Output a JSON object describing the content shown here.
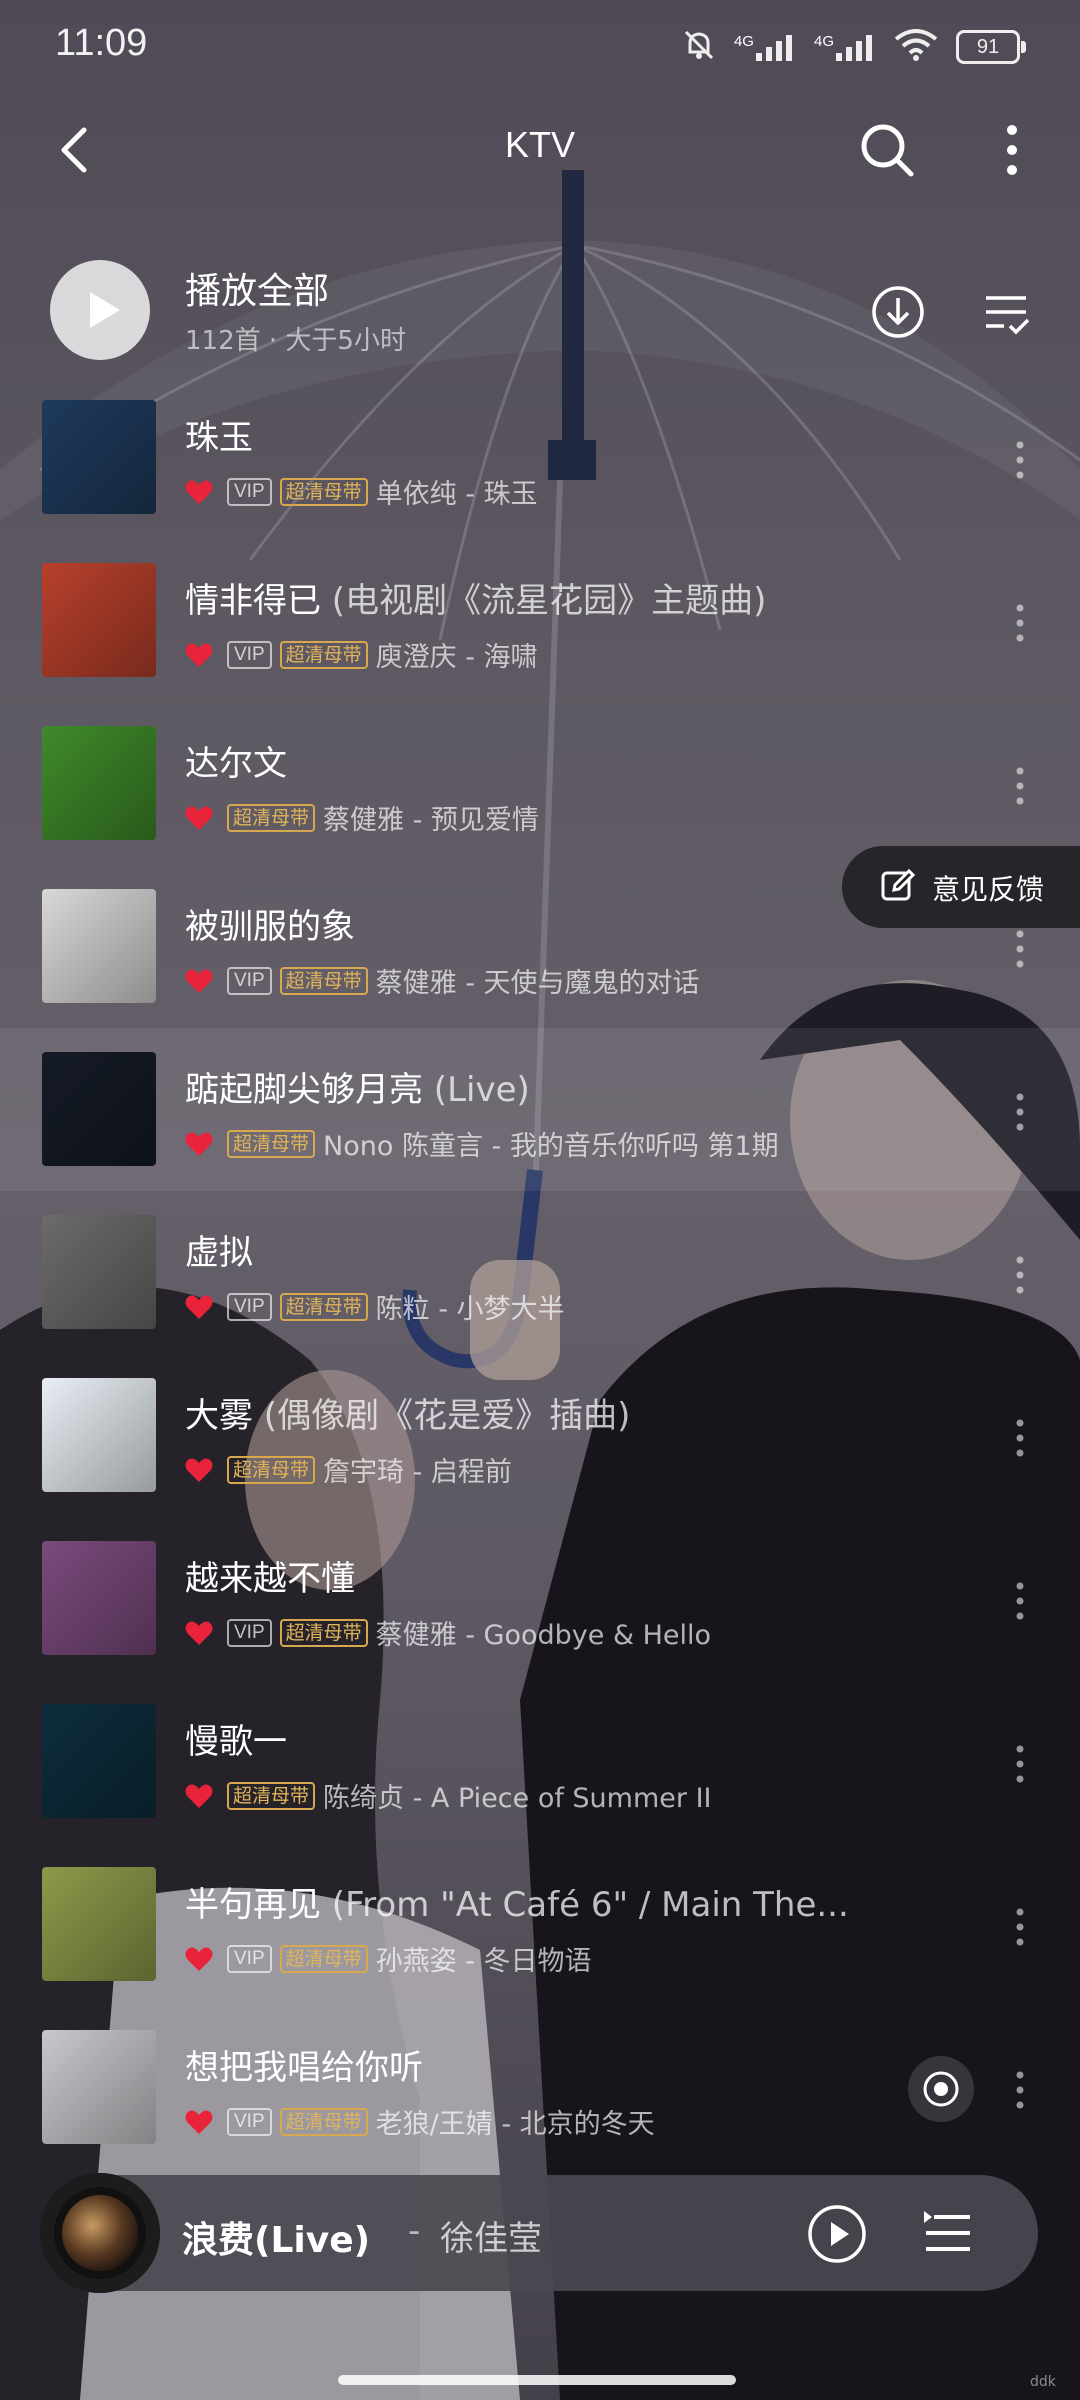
{
  "status_bar": {
    "time": "11:09",
    "net1": "4G",
    "net2": "4G",
    "battery": "91"
  },
  "header": {
    "title": "KTV",
    "icons": [
      "back-icon",
      "search-icon",
      "more-vertical-icon"
    ]
  },
  "play_all": {
    "label": "播放全部",
    "meta": "112首 · 大于5小时",
    "icons": [
      "play-icon",
      "download-icon",
      "multi-select-icon"
    ]
  },
  "tags": {
    "vip": "VIP",
    "hq": "超清母带"
  },
  "songs": [
    {
      "title": "珠玉",
      "subtitle": "",
      "vip": true,
      "hq": true,
      "artist_album": "单依纯 - 珠玉"
    },
    {
      "title": "情非得已",
      "subtitle": " (电视剧《流星花园》主题曲)",
      "vip": true,
      "hq": true,
      "artist_album": "庾澄庆 - 海啸"
    },
    {
      "title": "达尔文",
      "subtitle": "",
      "vip": false,
      "hq": true,
      "artist_album": "蔡健雅 - 预见爱情"
    },
    {
      "title": "被驯服的象",
      "subtitle": "",
      "vip": true,
      "hq": true,
      "artist_album": "蔡健雅 - 天使与魔鬼的对话"
    },
    {
      "title": "踮起脚尖够月亮",
      "subtitle": " (Live)",
      "vip": false,
      "hq": true,
      "artist_album": "Nono 陈童言 - 我的音乐你听吗 第1期"
    },
    {
      "title": "虚拟",
      "subtitle": "",
      "vip": true,
      "hq": true,
      "artist_album": "陈粒 - 小梦大半"
    },
    {
      "title": "大雾",
      "subtitle": " (偶像剧《花是爱》插曲)",
      "vip": false,
      "hq": true,
      "artist_album": "詹宇琦 - 启程前"
    },
    {
      "title": "越来越不懂",
      "subtitle": "",
      "vip": true,
      "hq": true,
      "artist_album": "蔡健雅 - Goodbye & Hello"
    },
    {
      "title": "慢歌一",
      "subtitle": "",
      "vip": false,
      "hq": true,
      "artist_album": "陈绮贞 - A Piece of Summer II"
    },
    {
      "title": "半句再见",
      "subtitle": " (From \"At Café 6\" / Main The...",
      "vip": true,
      "hq": true,
      "artist_album": "孙燕姿 - 冬日物语"
    },
    {
      "title": "想把我唱给你听",
      "subtitle": "",
      "vip": true,
      "hq": true,
      "artist_album": "老狼/王婧 - 北京的冬天"
    }
  ],
  "cover_colors": [
    "#1f3a5c",
    "#b8402c",
    "#3f8a2a",
    "#d8d8d8",
    "#151b26",
    "#6b6b6b",
    "#e8eef4",
    "#7a4a7c",
    "#0d2d3c",
    "#8c9a4a",
    "#c8c8cc"
  ],
  "feedback": {
    "label": "意见反馈"
  },
  "mini_player": {
    "title": "浪费(Live)",
    "separator": "-",
    "artist": "徐佳莹"
  },
  "accent_colors": {
    "heart": "#e8233a",
    "hq_tag": "#d8a84e"
  },
  "corner_mark": "ddk"
}
